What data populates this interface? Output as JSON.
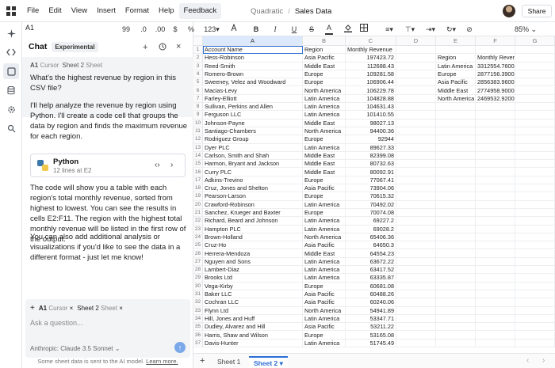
{
  "menubar": {
    "items": [
      "File",
      "Edit",
      "View",
      "Insert",
      "Format",
      "Help",
      "Feedback"
    ],
    "team": "Quadratic",
    "file_name": "Sales Data",
    "share_label": "Share"
  },
  "toolbar": {
    "cell_ref": "A1",
    "decimals_a": "99",
    "decimals_b": ".0",
    "decimals_c": ".00",
    "currency": "$",
    "percent": "%",
    "number_format": "123",
    "zoom": "85%"
  },
  "chat": {
    "title": "Chat",
    "badge": "Experimental",
    "user_context": {
      "cell": "A1",
      "cell_kind": "Cursor",
      "sheet": "Sheet 2",
      "sheet_kind": "Sheet"
    },
    "user_message": "What's the highest revenue by region in this CSV file?",
    "ai_intro": "I'll help analyze the revenue by region using Python. I'll create a code cell that groups the data by region and finds the maximum revenue for each region.",
    "code_card": {
      "language": "Python",
      "subtitle": "12 lines at E2"
    },
    "ai_result": "The code will show you a table with each region's total monthly revenue, sorted from highest to lowest. You can see the results in cells E2:F11. The region with the highest total monthly revenue will be listed in the first row of the output.",
    "ai_followup": "You can also add additional analysis or visualizations if you'd like to see the data in a different format - just let me know!",
    "input": {
      "ctx_cell": "A1",
      "ctx_cell_kind": "Cursor",
      "ctx_sheet": "Sheet 2",
      "ctx_sheet_kind": "Sheet",
      "placeholder": "Ask a question...",
      "model": "Anthropic: Claude 3.5 Sonnet"
    },
    "disclaimer": "Some sheet data is sent to the AI model.",
    "learn_more": "Learn more."
  },
  "grid": {
    "columns": [
      "A",
      "B",
      "C",
      "D",
      "E",
      "F",
      "G"
    ],
    "selected_column": "A",
    "rows": [
      [
        "Account Name",
        "Region",
        "Monthly Revenue"
      ],
      [
        "Hess-Robinson",
        "Asia Pacific",
        "197423.72"
      ],
      [
        "Reed-Smith",
        "Middle East",
        "112688.43"
      ],
      [
        "Romero-Brown",
        "Europe",
        "109281.58"
      ],
      [
        "Sweeney, Velez and Woodward",
        "Europe",
        "106906.44"
      ],
      [
        "Macias-Levy",
        "North America",
        "106229.78"
      ],
      [
        "Farley-Elliott",
        "Latin America",
        "104828.88"
      ],
      [
        "Sullivan, Perkins and Allen",
        "Latin America",
        "104631.43"
      ],
      [
        "Ferguson LLC",
        "Latin America",
        "101410.55"
      ],
      [
        "Johnson-Payne",
        "Middle East",
        "98027.13"
      ],
      [
        "Santiago-Chambers",
        "North America",
        "94400.36"
      ],
      [
        "Rodriguez Group",
        "Europe",
        "92944"
      ],
      [
        "Dyer PLC",
        "Latin America",
        "89627.33"
      ],
      [
        "Carlson, Smith and Shah",
        "Middle East",
        "82399.08"
      ],
      [
        "Harmon, Bryant and Jackson",
        "Middle East",
        "80732.63"
      ],
      [
        "Curry PLC",
        "Middle East",
        "80092.91"
      ],
      [
        "Adkins-Trevino",
        "Europe",
        "77067.41"
      ],
      [
        "Cruz, Jones and Shelton",
        "Asia Pacific",
        "73904.06"
      ],
      [
        "Pearson-Larson",
        "Europe",
        "70615.32"
      ],
      [
        "Crawford-Robinson",
        "Latin America",
        "70492.02"
      ],
      [
        "Sanchez, Krueger and Baxter",
        "Europe",
        "70074.08"
      ],
      [
        "Richard, Beard and Johnson",
        "Latin America",
        "69227.2"
      ],
      [
        "Hampton PLC",
        "Latin America",
        "69028.2"
      ],
      [
        "Brown-Holland",
        "North America",
        "65406.36"
      ],
      [
        "Cruz-Ho",
        "Asia Pacific",
        "64650.3"
      ],
      [
        "Herrera-Mendoza",
        "Middle East",
        "64554.23"
      ],
      [
        "Nguyen and Sons",
        "Latin America",
        "63672.22"
      ],
      [
        "Lambert-Diaz",
        "Latin America",
        "63417.52"
      ],
      [
        "Brooks Ltd",
        "Latin America",
        "63335.87"
      ],
      [
        "Vega-Kirby",
        "Europe",
        "60681.08"
      ],
      [
        "Baker LLC",
        "Asia Pacific",
        "60488.26"
      ],
      [
        "Cochran LLC",
        "Asia Pacific",
        "60240.06"
      ],
      [
        "Flynn Ltd",
        "North America",
        "54941.89"
      ],
      [
        "Hill, Jones and Huff",
        "Latin America",
        "53347.71"
      ],
      [
        "Dudley, Alvarez and Hill",
        "Asia Pacific",
        "53211.22"
      ],
      [
        "Harris, Shaw and Wilson",
        "Europe",
        "53165.08"
      ],
      [
        "Davis-Hunter",
        "Latin America",
        "51745.49"
      ]
    ],
    "summary": [
      [
        "Region",
        "Monthly Revenue"
      ],
      [
        "Latin America",
        "3312554.7600"
      ],
      [
        "Europe",
        "2877156.3900"
      ],
      [
        "Asia Pacific",
        "2856383.9600"
      ],
      [
        "Middle East",
        "2774958.9000"
      ],
      [
        "North America",
        "2469532.9200"
      ]
    ]
  },
  "sheets": {
    "tabs": [
      "Sheet 1",
      "Sheet 2"
    ],
    "active": "Sheet 2"
  }
}
